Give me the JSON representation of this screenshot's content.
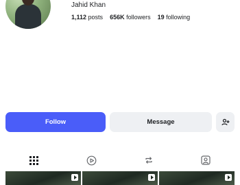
{
  "profile": {
    "name": "Jahid Khan",
    "posts": {
      "count": "1,112",
      "label": "posts"
    },
    "followers": {
      "count": "656K",
      "label": "followers"
    },
    "following": {
      "count": "19",
      "label": "following"
    }
  },
  "actions": {
    "follow_label": "Follow",
    "message_label": "Message",
    "add_friend_icon": "person-plus-icon"
  },
  "tabs": [
    {
      "icon": "grid-icon",
      "active": true
    },
    {
      "icon": "reels-icon",
      "active": false
    },
    {
      "icon": "repost-icon",
      "active": false
    },
    {
      "icon": "tagged-icon",
      "active": false
    }
  ],
  "colors": {
    "accent": "#4a5df9",
    "button_secondary": "#eef0f3",
    "text": "#1c1e21"
  }
}
